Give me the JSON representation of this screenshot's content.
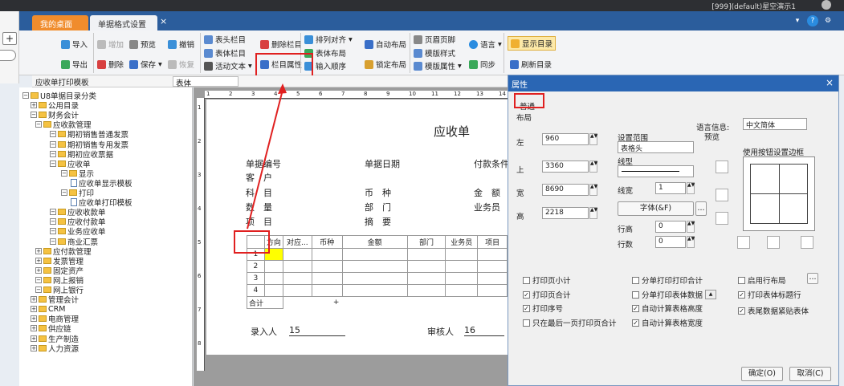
{
  "topbar": {
    "account": "[999](default)星空演示1"
  },
  "tabs": {
    "desktop": "我的桌面",
    "settings": "单据格式设置",
    "close": "×"
  },
  "topicons": {
    "down": "▾",
    "help": "?",
    "gear": "⚙",
    "person": "●"
  },
  "toolbar": {
    "import": "导入",
    "export": "导出",
    "add": "增加",
    "delete": "删除",
    "preview": "预览",
    "save": "保存",
    "undo": "撤销",
    "restore": "恢复",
    "header_col": "表头栏目",
    "body_col": "表体栏目",
    "active_text": "活动文本",
    "delete_col": "删除栏目",
    "col_props": "栏目属性",
    "arrange": "排列对齐",
    "body_layout": "表体布局",
    "input_order": "输入顺序",
    "auto_layout": "自动布局",
    "lock_layout": "锁定布局",
    "page_header": "页眉页脚",
    "template_style": "模版样式",
    "template_props": "模版属性",
    "language": "语言",
    "sync": "同步",
    "show_catalog": "显示目录",
    "refresh_catalog": "刷新目录"
  },
  "addrow": {
    "template": "应收单打印模板",
    "section": "表体"
  },
  "tree": {
    "items": [
      {
        "label": "U8单据目录分类",
        "level": 0
      },
      {
        "label": "公用目录",
        "level": 1
      },
      {
        "label": "财务会计",
        "level": 1
      },
      {
        "label": "应收款管理",
        "level": 2
      },
      {
        "label": "期初销售普通发票",
        "level": 3
      },
      {
        "label": "期初销售专用发票",
        "level": 3
      },
      {
        "label": "期初应收票据",
        "level": 3
      },
      {
        "label": "应收单",
        "level": 3
      },
      {
        "label": "显示",
        "level": 4
      },
      {
        "label": "应收单显示模板",
        "level": 5
      },
      {
        "label": "打印",
        "level": 4
      },
      {
        "label": "应收单打印模板",
        "level": 5
      },
      {
        "label": "应收收款单",
        "level": 3
      },
      {
        "label": "应收付款单",
        "level": 3
      },
      {
        "label": "业务应收单",
        "level": 3
      },
      {
        "label": "商业汇票",
        "level": 3
      },
      {
        "label": "应付款管理",
        "level": 2
      },
      {
        "label": "发票管理",
        "level": 2
      },
      {
        "label": "固定资产",
        "level": 2
      },
      {
        "label": "网上报销",
        "level": 2
      },
      {
        "label": "网上银行",
        "level": 2
      },
      {
        "label": "管理会计",
        "level": 1
      },
      {
        "label": "CRM",
        "level": 1
      },
      {
        "label": "电商管理",
        "level": 1
      },
      {
        "label": "供应链",
        "level": 1
      },
      {
        "label": "生产制造",
        "level": 1
      },
      {
        "label": "人力资源",
        "level": 1
      }
    ]
  },
  "paper": {
    "title": "应收单",
    "f1": "单据编号",
    "f2": "单据日期",
    "f3": "付款条件",
    "f4": "客　户",
    "f5": "科　目",
    "f6": "币　种",
    "f7": "金　额",
    "f8": "数　量",
    "f9": "部　门",
    "f10": "业务员",
    "f11": "项　目",
    "f12": "摘　要",
    "grid_headers": [
      "",
      "方向",
      "对应...",
      "币种",
      "金额",
      "部门",
      "业务员",
      "项目"
    ],
    "rows": [
      "1",
      "2",
      "3",
      "4"
    ],
    "total": "合计",
    "plus": "+",
    "entered_by": "录入人",
    "entered_val": "15",
    "reviewer": "审核人",
    "reviewer_val": "16"
  },
  "ruler": {
    "h": [
      "1",
      "2",
      "3",
      "4",
      "5",
      "6",
      "7",
      "8",
      "9",
      "10",
      "11",
      "12",
      "13",
      "14"
    ],
    "v": [
      "1",
      "2",
      "3",
      "4",
      "5",
      "6",
      "7",
      "8"
    ]
  },
  "dialog": {
    "title": "属性",
    "close": "×",
    "tab_general": "普通",
    "tab_layout": "布局",
    "left_label": "左",
    "left": "960",
    "top_label": "上",
    "top": "3360",
    "width_label": "宽",
    "width": "8690",
    "height_label": "高",
    "height": "2218",
    "range_label": "设置范围",
    "range": "表格头",
    "linetype_label": "线型",
    "linewidth_label": "线宽",
    "linewidth": "1",
    "font_btn": "字体(&F)",
    "ellipsis": "...",
    "rowheight_label": "行高",
    "rowheight": "0",
    "rowcount_label": "行数",
    "rowcount": "0",
    "lang_label": "语言信息:",
    "preview_label": "预览",
    "lang": "中文简体",
    "border_label": "使用按钮设置边框",
    "chk": {
      "page_subtotal": "打印页小计",
      "page_total": "打印页合计",
      "seq": "打印序号",
      "last_page_total": "只在最后一页打印页合计",
      "split_total": "分单打印打印合计",
      "split_body": "分单打印表体数据",
      "auto_height": "自动计算表格高度",
      "auto_width": "自动计算表格宽度",
      "row_layout": "启用行布局",
      "print_title_row": "打印表体标题行",
      "tail_follow": "表尾数据紧贴表体"
    },
    "ok": "确定(O)",
    "cancel": "取消(C)"
  },
  "colors": {
    "accent": "#2b5d9c",
    "tab_orange": "#f08c2c",
    "highlight": "#e02020",
    "cell_yellow": "#ffff00"
  }
}
